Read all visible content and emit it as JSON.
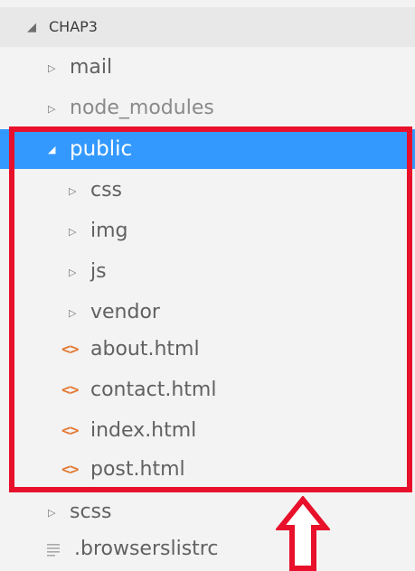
{
  "explorer": {
    "header": {
      "twisty": "◢",
      "label": "CHAP3"
    },
    "items": [
      {
        "twisty": "▷",
        "label": "mail"
      },
      {
        "twisty": "▷",
        "label": "node_modules"
      },
      {
        "twisty": "◢",
        "label": "public"
      },
      {
        "twisty": "▷",
        "label": "css"
      },
      {
        "twisty": "▷",
        "label": "img"
      },
      {
        "twisty": "▷",
        "label": "js"
      },
      {
        "twisty": "▷",
        "label": "vendor"
      },
      {
        "icon": "<>",
        "label": "about.html"
      },
      {
        "icon": "<>",
        "label": "contact.html"
      },
      {
        "icon": "<>",
        "label": "index.html"
      },
      {
        "icon": "<>",
        "label": "post.html"
      },
      {
        "twisty": "▷",
        "label": "scss"
      },
      {
        "icon": "lines-icon",
        "label": ".browserslistrc"
      }
    ]
  },
  "colors": {
    "selection": "#3399ff",
    "highlight": "#e8102a",
    "html_icon": "#e37933",
    "panel_bg": "#f3f3f3"
  }
}
